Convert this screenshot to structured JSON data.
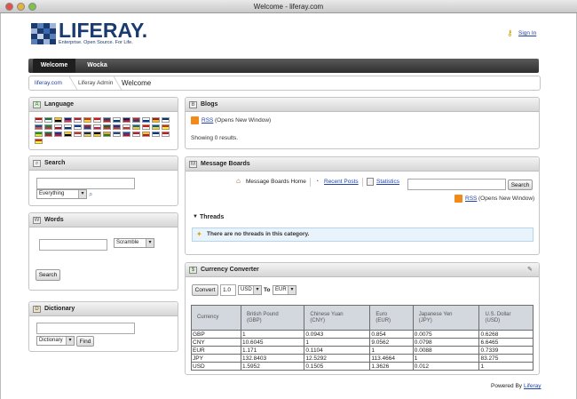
{
  "window": {
    "title": "Welcome - liferay.com"
  },
  "logo": {
    "name": "LIFERAY.",
    "tagline": "Enterprise. Open Source. For Life."
  },
  "header": {
    "sign_in": "Sign In"
  },
  "nav": {
    "tabs": [
      "Welcome",
      "Wocka"
    ]
  },
  "breadcrumb": [
    "liferay.com",
    "Liferay Admin",
    "Welcome"
  ],
  "language": {
    "title": "Language"
  },
  "search": {
    "title": "Search",
    "scope": "Everything"
  },
  "words": {
    "title": "Words",
    "mode": "Scramble",
    "button": "Search"
  },
  "dictionary": {
    "title": "Dictionary",
    "source": "Dictionary",
    "button": "Find"
  },
  "blogs": {
    "title": "Blogs",
    "rss": "RSS",
    "rss_note": "(Opens New Window)",
    "showing": "Showing 0 results."
  },
  "boards": {
    "title": "Message Boards",
    "links": [
      "Message Boards Home",
      "Recent Posts",
      "Statistics"
    ],
    "search_button": "Search",
    "rss": "RSS",
    "rss_note": "(Opens New Window)",
    "threads_title": "Threads",
    "no_threads": "There are no threads in this category."
  },
  "currency": {
    "title": "Currency Converter",
    "convert": "Convert",
    "amount": "1.0",
    "from": "USD",
    "to_label": "To",
    "to": "EUR",
    "headers": [
      {
        "name": "Currency",
        "code": ""
      },
      {
        "name": "British Pound",
        "code": "(GBP)"
      },
      {
        "name": "Chinese Yuan",
        "code": "(CNY)"
      },
      {
        "name": "Euro",
        "code": "(EUR)"
      },
      {
        "name": "Japanese Yen",
        "code": "(JPY)"
      },
      {
        "name": "U.S. Dollar",
        "code": "(USD)"
      }
    ],
    "rows": [
      [
        "GBP",
        "1",
        "0.0943",
        "0.854",
        "0.0075",
        "0.6268"
      ],
      [
        "CNY",
        "10.6045",
        "1",
        "9.0562",
        "0.0798",
        "6.6465"
      ],
      [
        "EUR",
        "1.171",
        "0.1104",
        "1",
        "0.0088",
        "0.7339"
      ],
      [
        "JPY",
        "132.8403",
        "12.5292",
        "113.4664",
        "1",
        "83.275"
      ],
      [
        "USD",
        "1.5952",
        "0.1505",
        "1.3626",
        "0.012",
        "1"
      ]
    ]
  },
  "footer": {
    "powered_by": "Powered By",
    "brand": "Liferay"
  },
  "colors": {
    "brand": "#1b3a6f",
    "nav": "#3a3a3a",
    "link": "#2244aa"
  }
}
